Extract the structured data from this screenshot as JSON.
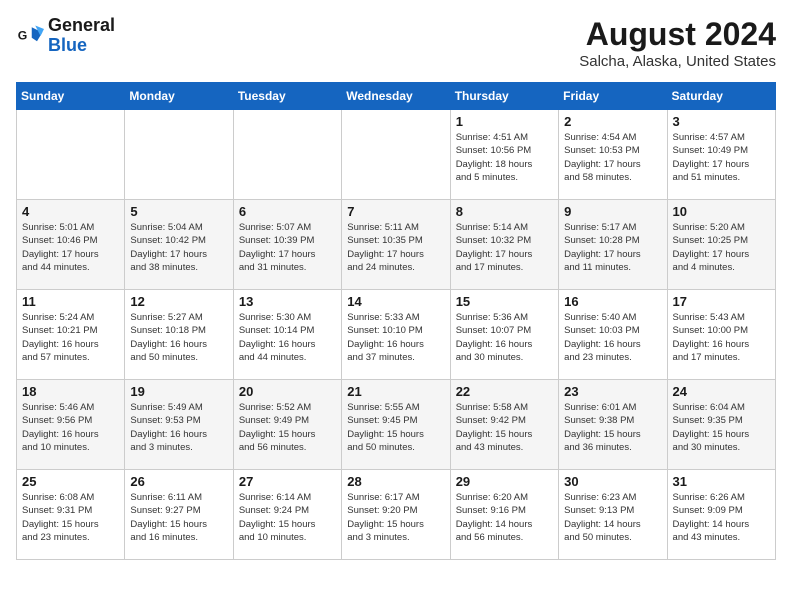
{
  "logo": {
    "text_general": "General",
    "text_blue": "Blue"
  },
  "header": {
    "title": "August 2024",
    "subtitle": "Salcha, Alaska, United States"
  },
  "days_of_week": [
    "Sunday",
    "Monday",
    "Tuesday",
    "Wednesday",
    "Thursday",
    "Friday",
    "Saturday"
  ],
  "weeks": [
    [
      {
        "day": "",
        "info": ""
      },
      {
        "day": "",
        "info": ""
      },
      {
        "day": "",
        "info": ""
      },
      {
        "day": "",
        "info": ""
      },
      {
        "day": "1",
        "info": "Sunrise: 4:51 AM\nSunset: 10:56 PM\nDaylight: 18 hours\nand 5 minutes."
      },
      {
        "day": "2",
        "info": "Sunrise: 4:54 AM\nSunset: 10:53 PM\nDaylight: 17 hours\nand 58 minutes."
      },
      {
        "day": "3",
        "info": "Sunrise: 4:57 AM\nSunset: 10:49 PM\nDaylight: 17 hours\nand 51 minutes."
      }
    ],
    [
      {
        "day": "4",
        "info": "Sunrise: 5:01 AM\nSunset: 10:46 PM\nDaylight: 17 hours\nand 44 minutes."
      },
      {
        "day": "5",
        "info": "Sunrise: 5:04 AM\nSunset: 10:42 PM\nDaylight: 17 hours\nand 38 minutes."
      },
      {
        "day": "6",
        "info": "Sunrise: 5:07 AM\nSunset: 10:39 PM\nDaylight: 17 hours\nand 31 minutes."
      },
      {
        "day": "7",
        "info": "Sunrise: 5:11 AM\nSunset: 10:35 PM\nDaylight: 17 hours\nand 24 minutes."
      },
      {
        "day": "8",
        "info": "Sunrise: 5:14 AM\nSunset: 10:32 PM\nDaylight: 17 hours\nand 17 minutes."
      },
      {
        "day": "9",
        "info": "Sunrise: 5:17 AM\nSunset: 10:28 PM\nDaylight: 17 hours\nand 11 minutes."
      },
      {
        "day": "10",
        "info": "Sunrise: 5:20 AM\nSunset: 10:25 PM\nDaylight: 17 hours\nand 4 minutes."
      }
    ],
    [
      {
        "day": "11",
        "info": "Sunrise: 5:24 AM\nSunset: 10:21 PM\nDaylight: 16 hours\nand 57 minutes."
      },
      {
        "day": "12",
        "info": "Sunrise: 5:27 AM\nSunset: 10:18 PM\nDaylight: 16 hours\nand 50 minutes."
      },
      {
        "day": "13",
        "info": "Sunrise: 5:30 AM\nSunset: 10:14 PM\nDaylight: 16 hours\nand 44 minutes."
      },
      {
        "day": "14",
        "info": "Sunrise: 5:33 AM\nSunset: 10:10 PM\nDaylight: 16 hours\nand 37 minutes."
      },
      {
        "day": "15",
        "info": "Sunrise: 5:36 AM\nSunset: 10:07 PM\nDaylight: 16 hours\nand 30 minutes."
      },
      {
        "day": "16",
        "info": "Sunrise: 5:40 AM\nSunset: 10:03 PM\nDaylight: 16 hours\nand 23 minutes."
      },
      {
        "day": "17",
        "info": "Sunrise: 5:43 AM\nSunset: 10:00 PM\nDaylight: 16 hours\nand 17 minutes."
      }
    ],
    [
      {
        "day": "18",
        "info": "Sunrise: 5:46 AM\nSunset: 9:56 PM\nDaylight: 16 hours\nand 10 minutes."
      },
      {
        "day": "19",
        "info": "Sunrise: 5:49 AM\nSunset: 9:53 PM\nDaylight: 16 hours\nand 3 minutes."
      },
      {
        "day": "20",
        "info": "Sunrise: 5:52 AM\nSunset: 9:49 PM\nDaylight: 15 hours\nand 56 minutes."
      },
      {
        "day": "21",
        "info": "Sunrise: 5:55 AM\nSunset: 9:45 PM\nDaylight: 15 hours\nand 50 minutes."
      },
      {
        "day": "22",
        "info": "Sunrise: 5:58 AM\nSunset: 9:42 PM\nDaylight: 15 hours\nand 43 minutes."
      },
      {
        "day": "23",
        "info": "Sunrise: 6:01 AM\nSunset: 9:38 PM\nDaylight: 15 hours\nand 36 minutes."
      },
      {
        "day": "24",
        "info": "Sunrise: 6:04 AM\nSunset: 9:35 PM\nDaylight: 15 hours\nand 30 minutes."
      }
    ],
    [
      {
        "day": "25",
        "info": "Sunrise: 6:08 AM\nSunset: 9:31 PM\nDaylight: 15 hours\nand 23 minutes."
      },
      {
        "day": "26",
        "info": "Sunrise: 6:11 AM\nSunset: 9:27 PM\nDaylight: 15 hours\nand 16 minutes."
      },
      {
        "day": "27",
        "info": "Sunrise: 6:14 AM\nSunset: 9:24 PM\nDaylight: 15 hours\nand 10 minutes."
      },
      {
        "day": "28",
        "info": "Sunrise: 6:17 AM\nSunset: 9:20 PM\nDaylight: 15 hours\nand 3 minutes."
      },
      {
        "day": "29",
        "info": "Sunrise: 6:20 AM\nSunset: 9:16 PM\nDaylight: 14 hours\nand 56 minutes."
      },
      {
        "day": "30",
        "info": "Sunrise: 6:23 AM\nSunset: 9:13 PM\nDaylight: 14 hours\nand 50 minutes."
      },
      {
        "day": "31",
        "info": "Sunrise: 6:26 AM\nSunset: 9:09 PM\nDaylight: 14 hours\nand 43 minutes."
      }
    ]
  ]
}
